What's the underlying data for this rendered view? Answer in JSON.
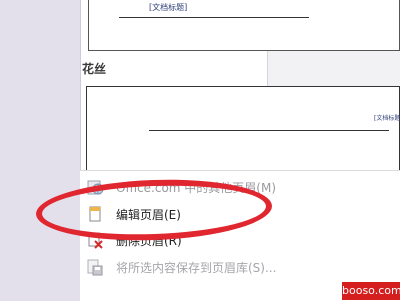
{
  "gallery": {
    "top_thumb_tag": "[文档标题]",
    "section_label": "花丝",
    "huasi_thumb_tag": "[文档标题]"
  },
  "menu": {
    "items": [
      {
        "label": "Office.com 中的其他页眉(M)",
        "icon": "office-globe-icon"
      },
      {
        "label": "编辑页眉(E)",
        "icon": "edit-header-icon"
      },
      {
        "label": "删除页眉(R)",
        "icon": "delete-header-icon"
      },
      {
        "label": "将所选内容保存到页眉库(S)...",
        "icon": "save-to-gallery-icon"
      }
    ]
  },
  "watermark": {
    "text": "booso.com"
  },
  "colors": {
    "annotation_red": "#e0262f",
    "watermark_red": "#d51e1e",
    "tag_blue": "#2f3f7a"
  }
}
